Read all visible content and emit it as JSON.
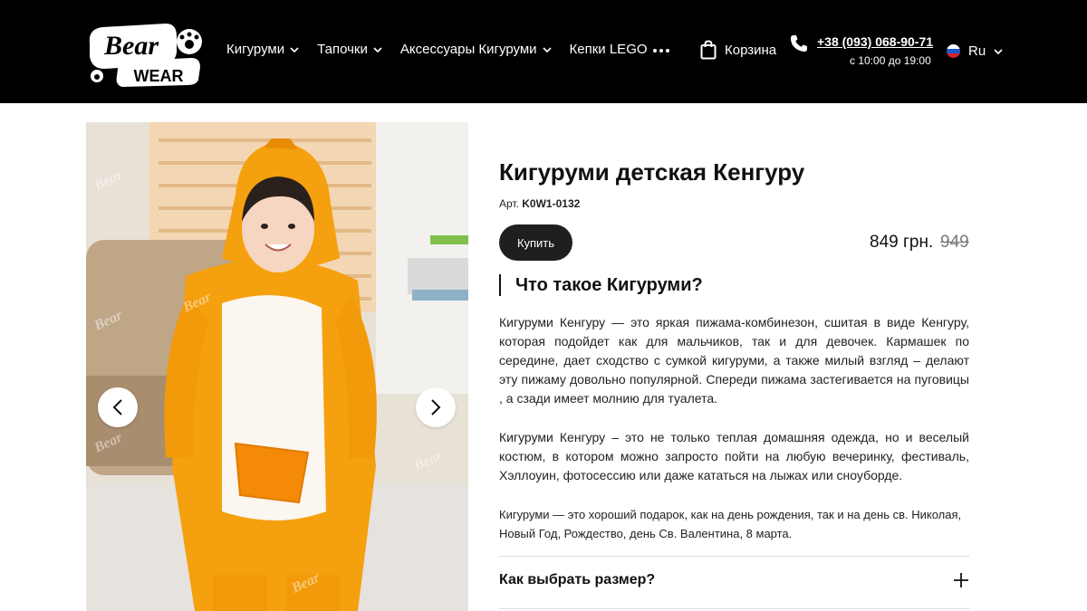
{
  "header": {
    "logo_text_top": "Bear",
    "logo_text_bottom": "WEAR",
    "nav": [
      {
        "label": "Кигуруми",
        "has_dropdown": true
      },
      {
        "label": "Тапочки",
        "has_dropdown": true
      },
      {
        "label": "Аксессуары Кигуруми",
        "has_dropdown": true
      },
      {
        "label": "Кепки LEGO",
        "has_dropdown": false
      }
    ],
    "more_icon": "more-dots-icon",
    "cart_label": "Корзина",
    "phone": "+38 (093) 068-90-71",
    "hours": "с 10:00 до 19:00",
    "language": "Ru"
  },
  "product": {
    "title": "Кигуруми детская Кенгуру",
    "sku_label": "Арт.",
    "sku": "K0W1-0132",
    "buy_label": "Купить",
    "price": "849 грн.",
    "old_price": "949",
    "section_heading": "Что такое Кигуруми?",
    "description_1": "Кигуруми Кенгуру — это яркая пижама-комбинезон, сшитая в виде Кенгуру, которая подойдет как для мальчиков, так и для девочек. Кармашек по середине, дает сходство с сумкой кигуруми, а также милый взгляд – делают эту пижаму довольно популярной. Спереди пижама застегивается на пуговицы , а сзади имеет молнию для туалета.",
    "description_2": "Кигуруми Кенгуру – это не только теплая домашняя одежда, но и веселый костюм, в котором можно запросто пойти на любую вечеринку, фестиваль, Хэллоуин, фотосессию или даже кататься на лыжах или сноуборде.",
    "description_3": "Кигуруми — это хороший подарок, как на день рождения, так и на день св. Николая, Новый Год, Рождество, день Св. Валентина, 8 марта.",
    "faq_label": "Как выбрать размер?"
  },
  "colors": {
    "header_bg": "#000000",
    "costume_orange": "#f5a00f",
    "buy_button": "#1f1f1f"
  }
}
